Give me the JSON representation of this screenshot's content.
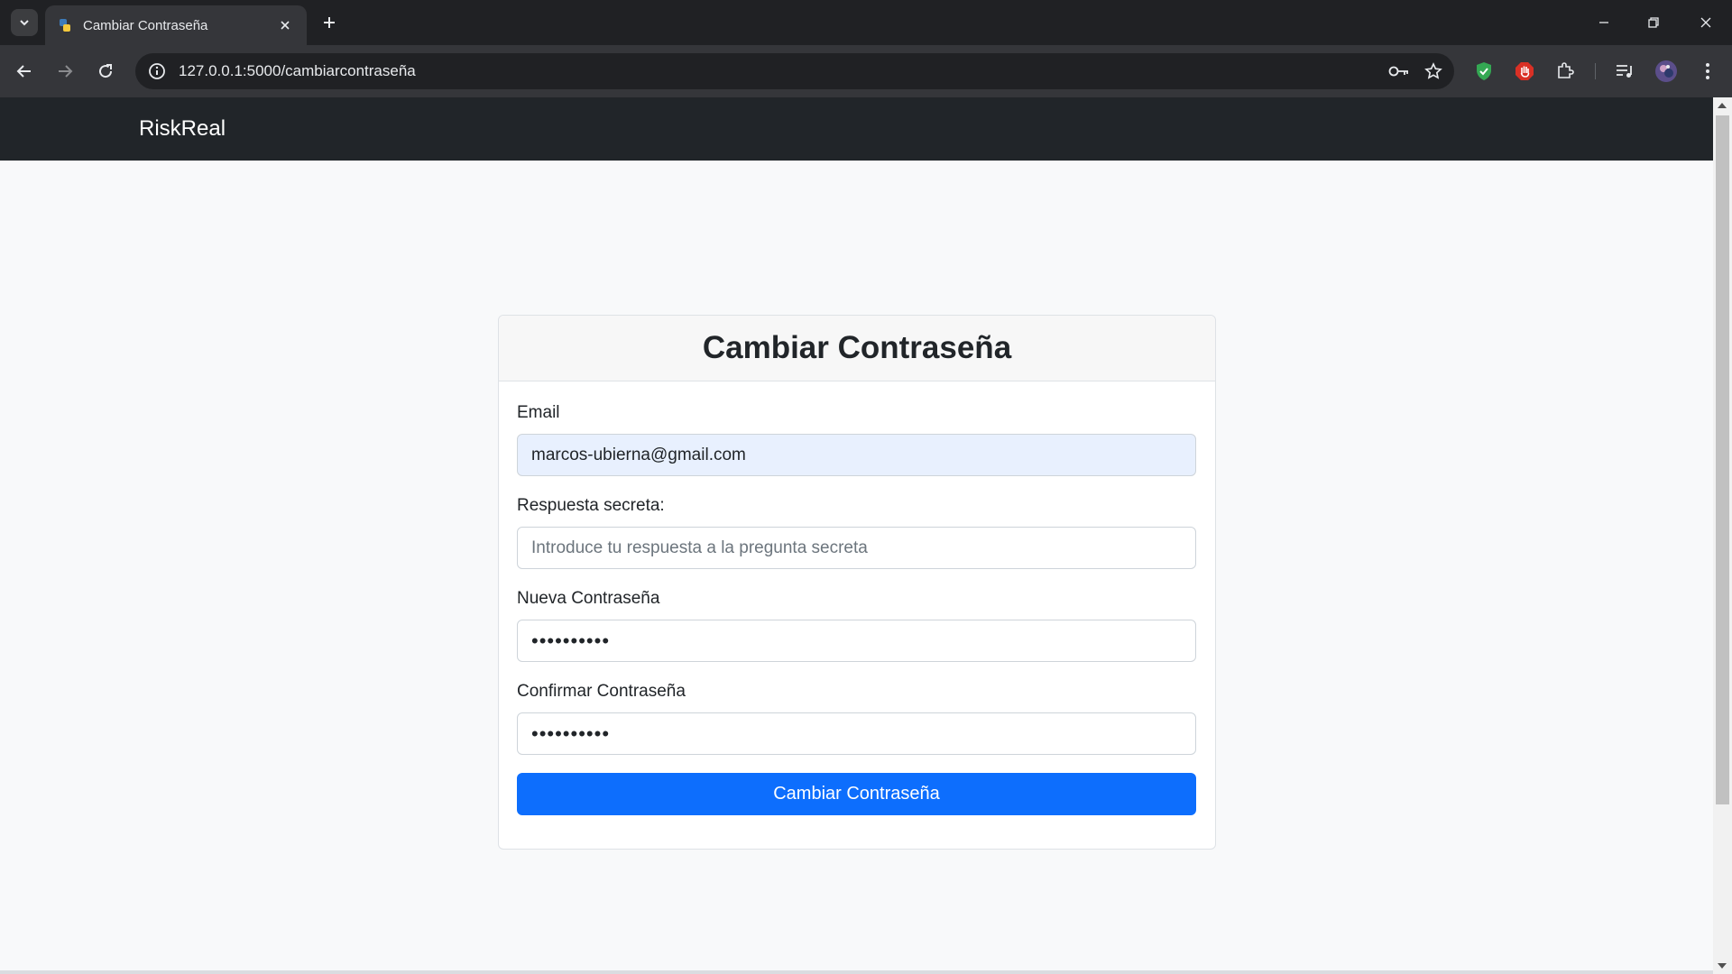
{
  "browser": {
    "tab_title": "Cambiar Contraseña",
    "url": "127.0.0.1:5000/cambiarcontraseña"
  },
  "icons": {
    "tab_search": "chevron-down-icon",
    "favicon": "python-favicon-icon",
    "tab_close": "close-icon",
    "new_tab": "plus-icon",
    "back": "arrow-left-icon",
    "forward": "arrow-right-icon",
    "reload": "reload-icon",
    "site_info": "info-icon",
    "password_key": "key-icon",
    "bookmark": "star-icon",
    "extensions": [
      "shield-check-icon",
      "stop-hand-icon",
      "puzzle-icon",
      "media-queue-icon",
      "avatar"
    ],
    "menu": "kebab-menu-icon"
  },
  "colors": {
    "navbar": "#212529",
    "primary": "#0d6efd",
    "autofill": "#e8f0fe"
  },
  "navbar": {
    "brand": "RiskReal"
  },
  "form": {
    "title": "Cambiar Contraseña",
    "email_label": "Email",
    "email_value": "marcos-ubierna@gmail.com",
    "secret_label": "Respuesta secreta:",
    "secret_placeholder": "Introduce tu respuesta a la pregunta secreta",
    "new_password_label": "Nueva Contraseña",
    "new_password_value": "••••••••••",
    "confirm_password_label": "Confirmar Contraseña",
    "confirm_password_value": "••••••••••",
    "submit_label": "Cambiar Contraseña"
  }
}
